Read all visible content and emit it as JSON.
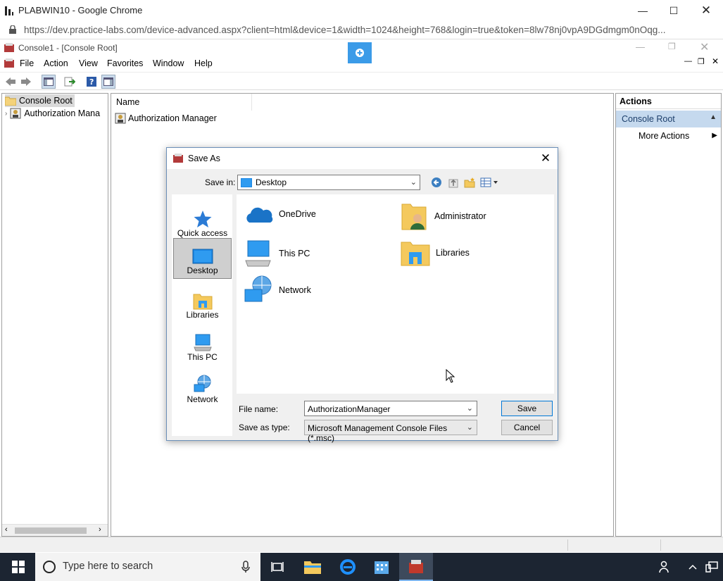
{
  "browser": {
    "title": "PLABWIN10 - Google Chrome",
    "url": "https://dev.practice-labs.com/device-advanced.aspx?client=html&device=1&width=1024&height=768&login=true&token=8lw78nj0vpA9DGdmgm0nOqg..."
  },
  "mmc": {
    "title": "Console1 - [Console Root]",
    "menu": [
      "File",
      "Action",
      "View",
      "Favorites",
      "Window",
      "Help"
    ],
    "tree": {
      "root": "Console Root",
      "child": "Authorization Mana"
    },
    "result": {
      "column_name": "Name",
      "item": "Authorization Manager"
    },
    "actions": {
      "header": "Actions",
      "section": "Console Root",
      "more": "More Actions"
    }
  },
  "dialog": {
    "title": "Save As",
    "save_in_label": "Save in:",
    "save_in_value": "Desktop",
    "places": [
      "Quick access",
      "Desktop",
      "Libraries",
      "This PC",
      "Network"
    ],
    "files": [
      "OneDrive",
      "Administrator",
      "This PC",
      "Libraries",
      "Network"
    ],
    "file_name_label": "File name:",
    "file_name_value": "AuthorizationManager",
    "save_type_label": "Save as type:",
    "save_type_value": "Microsoft Management Console Files (*.msc)",
    "save_button": "Save",
    "cancel_button": "Cancel"
  },
  "taskbar": {
    "search_placeholder": "Type here to search"
  },
  "colors": {
    "accent": "#0078d7",
    "taskbar": "#1c2532",
    "actions_section": "#c5d9ee",
    "float_button": "#3b9be8"
  }
}
